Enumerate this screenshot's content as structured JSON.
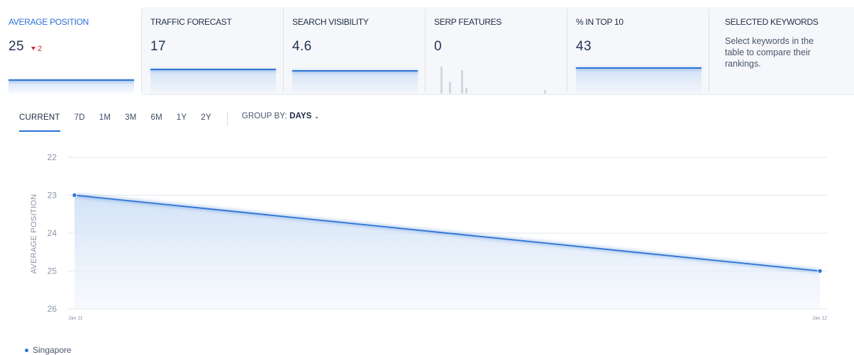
{
  "cards": [
    {
      "title": "AVERAGE POSITION",
      "value": "25",
      "delta": "2",
      "active": true
    },
    {
      "title": "TRAFFIC FORECAST",
      "value": "17",
      "active": false
    },
    {
      "title": "SEARCH VISIBILITY",
      "value": "4.6",
      "active": false
    },
    {
      "title": "SERP FEATURES",
      "value": "0",
      "active": false
    },
    {
      "title": "% IN TOP 10",
      "value": "43",
      "active": false
    },
    {
      "title": "SELECTED KEYWORDS",
      "description": "Select keywords in the table to compare their rankings.",
      "active": false
    }
  ],
  "toolbar": {
    "periods": [
      "CURRENT",
      "7D",
      "1M",
      "3M",
      "6M",
      "1Y",
      "2Y"
    ],
    "active_period": "CURRENT",
    "group_by_label": "GROUP BY:",
    "group_by_value": "DAYS"
  },
  "colors": {
    "accent": "#2a70d6",
    "series": "#2d74d4",
    "delta_down": "#d6243a",
    "grid": "#e3e7ee"
  },
  "chart_data": {
    "type": "area",
    "ylabel": "AVERAGE POSITION",
    "y_inverted": true,
    "ylim": [
      22,
      26
    ],
    "yticks": [
      22,
      23,
      24,
      25,
      26
    ],
    "x": [
      "Jan 11",
      "Jan 12"
    ],
    "series": [
      {
        "name": "Singapore",
        "values": [
          23,
          25
        ]
      }
    ],
    "grid": true,
    "legend": "bottom-left"
  }
}
